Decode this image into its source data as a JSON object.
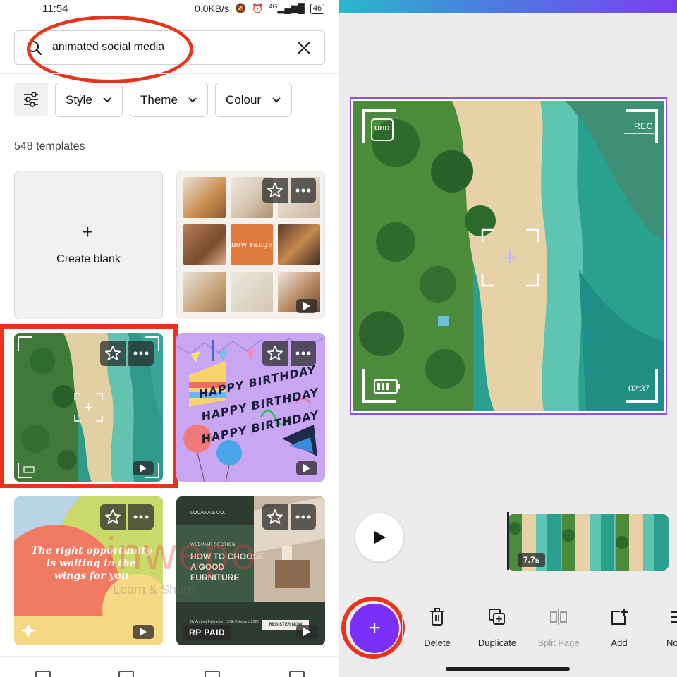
{
  "status_bar": {
    "time": "11:54",
    "network_speed": "0.0KB/s",
    "signal_label": "4G",
    "battery": "46"
  },
  "search": {
    "query": "animated social media"
  },
  "filters": {
    "style_label": "Style",
    "theme_label": "Theme",
    "colour_label": "Colour"
  },
  "results": {
    "count_text": "548 templates",
    "create_blank_label": "Create blank"
  },
  "templates": {
    "candle_tile_text": "new range",
    "birthday_line1": "HAPPY BIRTHDAY",
    "birthday_line2": "HAPPY BIRTHDAY",
    "birthday_line3": "HAPPY BIRTHDAY",
    "opportunity_text": "The right opportunity is waiting in the wings for you",
    "furniture_logo": "LOCANA & CO.",
    "furniture_section": "WEBINAR SECTION",
    "furniture_heading": "HOW TO CHOOSE A GOOD FURNITURE",
    "furniture_footer": "By Andrea Fullmerton | 27th February, 2022",
    "furniture_cta": "REGISTER NOW",
    "paid_badge": "RP PAID"
  },
  "watermark": {
    "main": "inwepo",
    "sub": "Learn & Share"
  },
  "editor": {
    "camera_uhd_label": "UHD",
    "camera_rec_label": "REC",
    "camera_time": "02:37",
    "clip_duration": "7.7s"
  },
  "toolbar": {
    "delete_label": "Delete",
    "duplicate_label": "Duplicate",
    "split_page_label": "Split Page",
    "add_label": "Add",
    "next_label": "No"
  },
  "colors": {
    "accent_purple": "#7b2ff7",
    "highlight_red": "#e8341c",
    "preview_border": "#8a54e8"
  }
}
